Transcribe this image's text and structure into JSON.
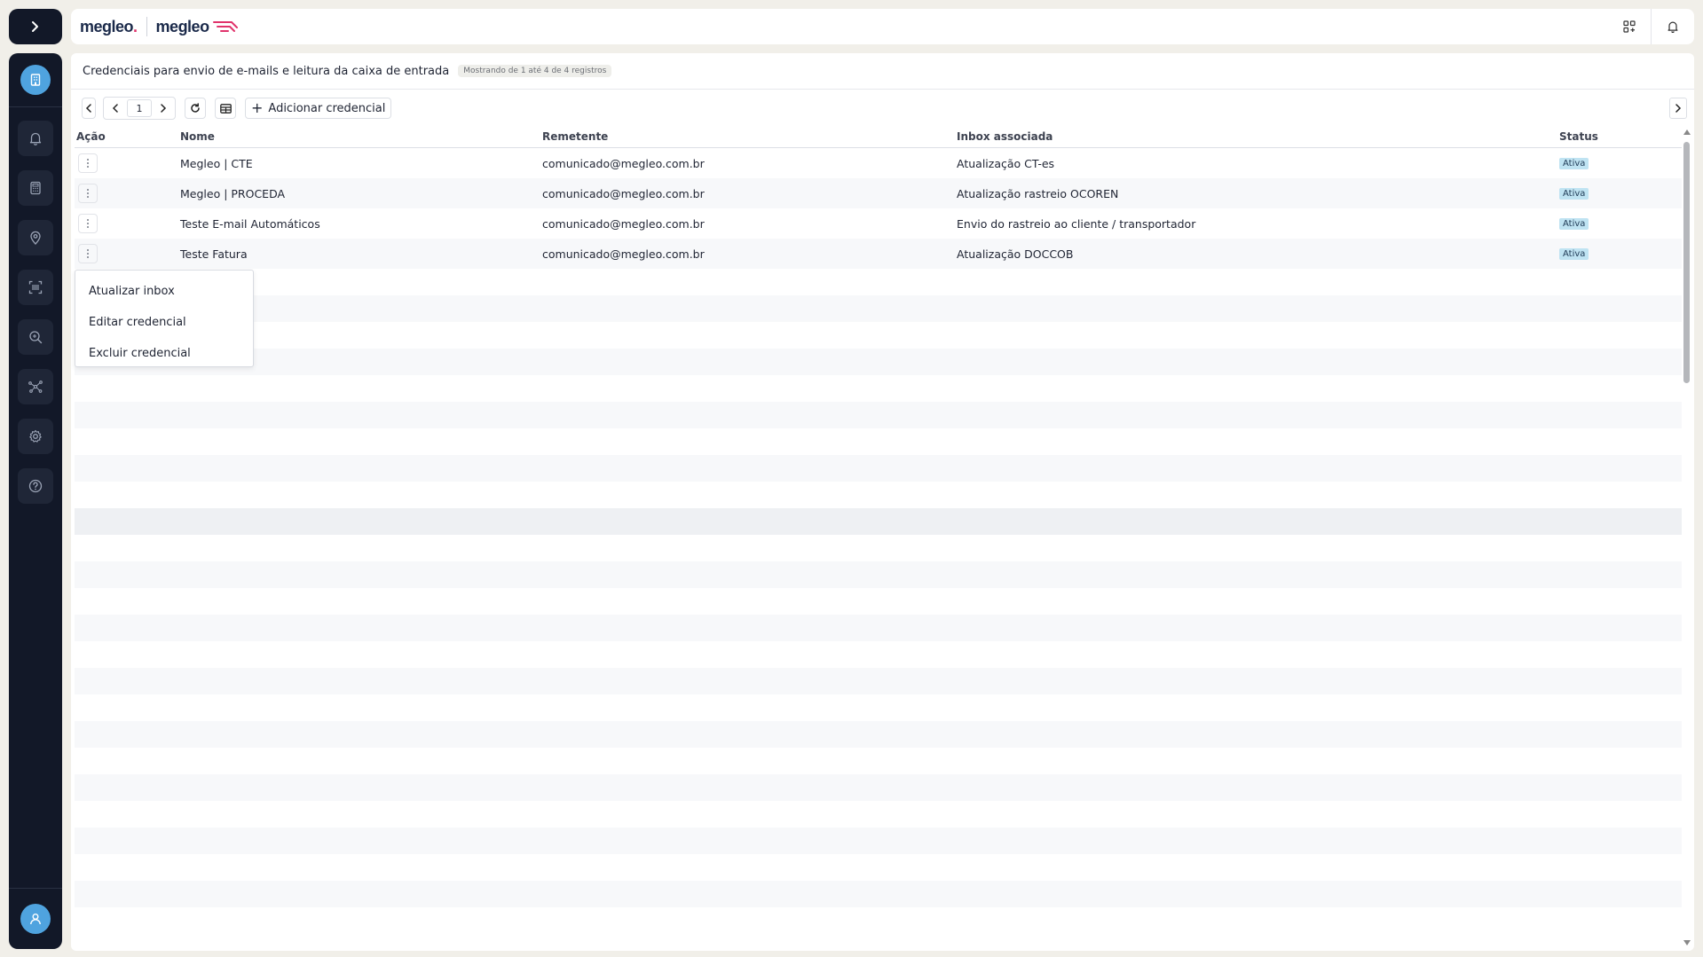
{
  "brand": {
    "logo_primary": "megleo",
    "logo_primary_dot": ".",
    "logo_secondary": "megleo",
    "accent": "#e0336b",
    "sidebar_bg": "#121828",
    "active_blue": "#4fa3df"
  },
  "sidebar": {
    "toggle_icon": "chevron-right-icon",
    "active_icon": "building-icon",
    "items": [
      {
        "icon": "bell-icon"
      },
      {
        "icon": "calculator-icon"
      },
      {
        "icon": "map-pin-icon"
      },
      {
        "icon": "barcode-scan-icon"
      },
      {
        "icon": "search-zoom-icon"
      },
      {
        "icon": "network-icon"
      },
      {
        "icon": "gear-icon"
      },
      {
        "icon": "help-icon"
      }
    ],
    "user_icon": "user-icon"
  },
  "topbar": {
    "right_icons": [
      "apps-add-icon",
      "bell-icon"
    ]
  },
  "panel": {
    "title": "Credenciais para envio de e-mails e leitura da caixa de entrada",
    "count_badge": "Mostrando de 1 até 4 de 4 registros"
  },
  "toolbar": {
    "page": "1",
    "add_label": "Adicionar credencial"
  },
  "table": {
    "headers": {
      "acao": "Ação",
      "nome": "Nome",
      "remetente": "Remetente",
      "inbox": "Inbox associada",
      "status": "Status"
    },
    "rows": [
      {
        "nome": "Megleo | CTE",
        "remetente": "comunicado@megleo.com.br",
        "inbox": "Atualização CT-es",
        "status": "Ativa"
      },
      {
        "nome": "Megleo | PROCEDA",
        "remetente": "comunicado@megleo.com.br",
        "inbox": "Atualização rastreio OCOREN",
        "status": "Ativa"
      },
      {
        "nome": "Teste E-mail Automáticos",
        "remetente": "comunicado@megleo.com.br",
        "inbox": "Envio do rastreio ao cliente / transportador",
        "status": "Ativa"
      },
      {
        "nome": "Teste Fatura",
        "remetente": "comunicado@megleo.com.br",
        "inbox": "Atualização DOCCOB",
        "status": "Ativa"
      }
    ]
  },
  "context_menu": {
    "items": [
      "Atualizar inbox",
      "Editar credencial",
      "Excluir credencial"
    ]
  }
}
